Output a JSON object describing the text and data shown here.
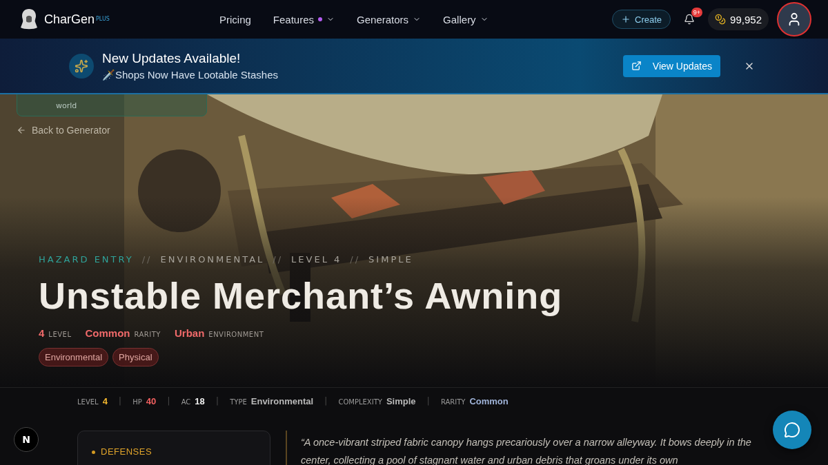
{
  "brand": {
    "name": "CharGen",
    "tier": "PLUS"
  },
  "nav": [
    {
      "label": "Pricing",
      "dropdown": false,
      "dot": false
    },
    {
      "label": "Features",
      "dropdown": true,
      "dot": true
    },
    {
      "label": "Generators",
      "dropdown": true,
      "dot": false
    },
    {
      "label": "Gallery",
      "dropdown": true,
      "dot": false
    }
  ],
  "create_button": "Create",
  "notifications": {
    "badge": "9+"
  },
  "coins": "99,952",
  "banner": {
    "title": "New Updates Available!",
    "subtitle": "🗡️Shops Now Have Lootable Stashes",
    "button": "View Updates"
  },
  "hidden_card": {
    "text": "world"
  },
  "back_link": "Back to Generator",
  "hero": {
    "picture": {
      "kind": "picture"
    },
    "breadcrumb": [
      {
        "label": "HAZARD ENTRY",
        "selected": true
      },
      {
        "label": "ENVIRONMENTAL",
        "selected": false
      },
      {
        "label": "LEVEL 4",
        "selected": false
      },
      {
        "label": "SIMPLE",
        "selected": false
      }
    ],
    "separator": "//",
    "title": "Unstable Merchant’s Awning",
    "facts": [
      {
        "value": "4",
        "label": "LEVEL"
      },
      {
        "value": "Common",
        "label": "RARITY"
      },
      {
        "value": "Urban",
        "label": "ENVIRONMENT"
      }
    ],
    "tags": [
      "Environmental",
      "Physical"
    ]
  },
  "stats": [
    {
      "label": "LEVEL",
      "value": "4",
      "color": "#f5b82e"
    },
    {
      "label": "HP",
      "value": "40",
      "color": "#f26060"
    },
    {
      "label": "AC",
      "value": "18",
      "color": "#f0f0f0"
    },
    {
      "label": "TYPE",
      "value": "Environmental",
      "color": "#b8b8b8"
    },
    {
      "label": "COMPLEXITY",
      "value": "Simple",
      "color": "#b8b8b8"
    },
    {
      "label": "RARITY",
      "value": "Common",
      "color": "#9fb3d8"
    }
  ],
  "stat_separator": "|",
  "defenses": {
    "title": "DEFENSES"
  },
  "description": "“A once-vibrant striped fabric canopy hangs precariously over a narrow alleyway. It bows deeply in the center, collecting a pool of stagnant water and urban debris that groans under its own",
  "corner_badge": "N"
}
